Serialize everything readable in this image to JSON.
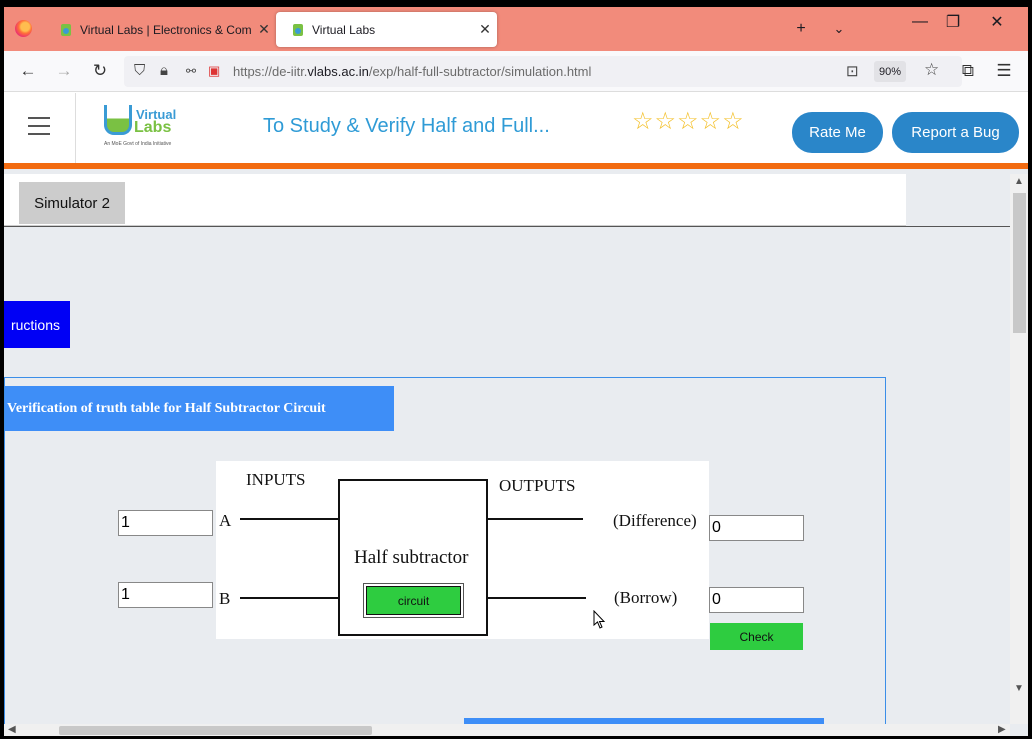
{
  "browser": {
    "tabs": [
      {
        "title": "Virtual Labs | Electronics & Com"
      },
      {
        "title": "Virtual Labs"
      }
    ],
    "url_prefix": "https://de-iitr.",
    "url_domain": "vlabs.ac.in",
    "url_path": "/exp/half-full-subtractor/simulation.html",
    "zoom": "90%"
  },
  "site": {
    "logo_top": "Virtual",
    "logo_bottom": "Labs",
    "logo_tagline": "An MoE Govt of India Initiative",
    "title": "To Study & Verify Half and Full...",
    "stars": "☆☆☆☆☆",
    "rate_label": "Rate Me",
    "bug_label": "Report a Bug"
  },
  "sim": {
    "tab_label": "Simulator 2",
    "instructions_label": "ructions",
    "panel_title": "Verification of truth table for Half Subtractor Circuit",
    "inputs_label": "INPUTS",
    "outputs_label": "OUTPUTS",
    "a_label": "A",
    "b_label": "B",
    "block_label": "Half subtractor",
    "circuit_label": "circuit",
    "difference_label": "(Difference)",
    "borrow_label": "(Borrow)",
    "input_a": "1",
    "input_b": "1",
    "difference_value": "0",
    "borrow_value": "0",
    "check_label": "Check"
  }
}
